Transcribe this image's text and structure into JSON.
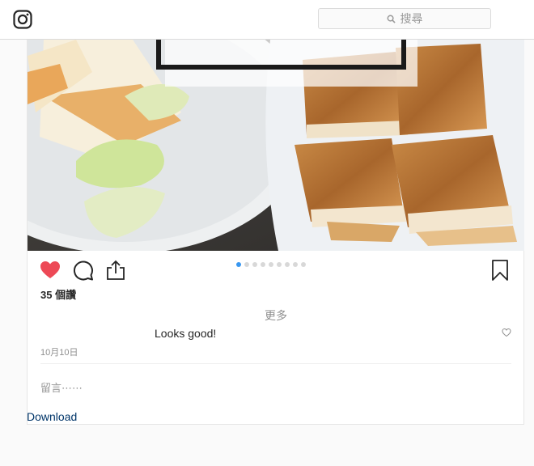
{
  "header": {
    "search_placeholder": "搜尋"
  },
  "post": {
    "carousel": {
      "count": 9,
      "active_index": 0
    },
    "likes_text": "35 個讚",
    "more_text": "更多",
    "comment": {
      "text": "Looks good!"
    },
    "date": "10月10日",
    "add_comment_placeholder": "留言⋯⋯",
    "liked": true
  },
  "footer": {
    "download_label": "Download"
  },
  "colors": {
    "like_red": "#ed4956",
    "carousel_active": "#3897f0",
    "link_blue": "#003569"
  },
  "icons": [
    "instagram-icon",
    "search-icon",
    "heart-icon",
    "comment-icon",
    "share-icon",
    "bookmark-icon",
    "small-heart-icon"
  ]
}
